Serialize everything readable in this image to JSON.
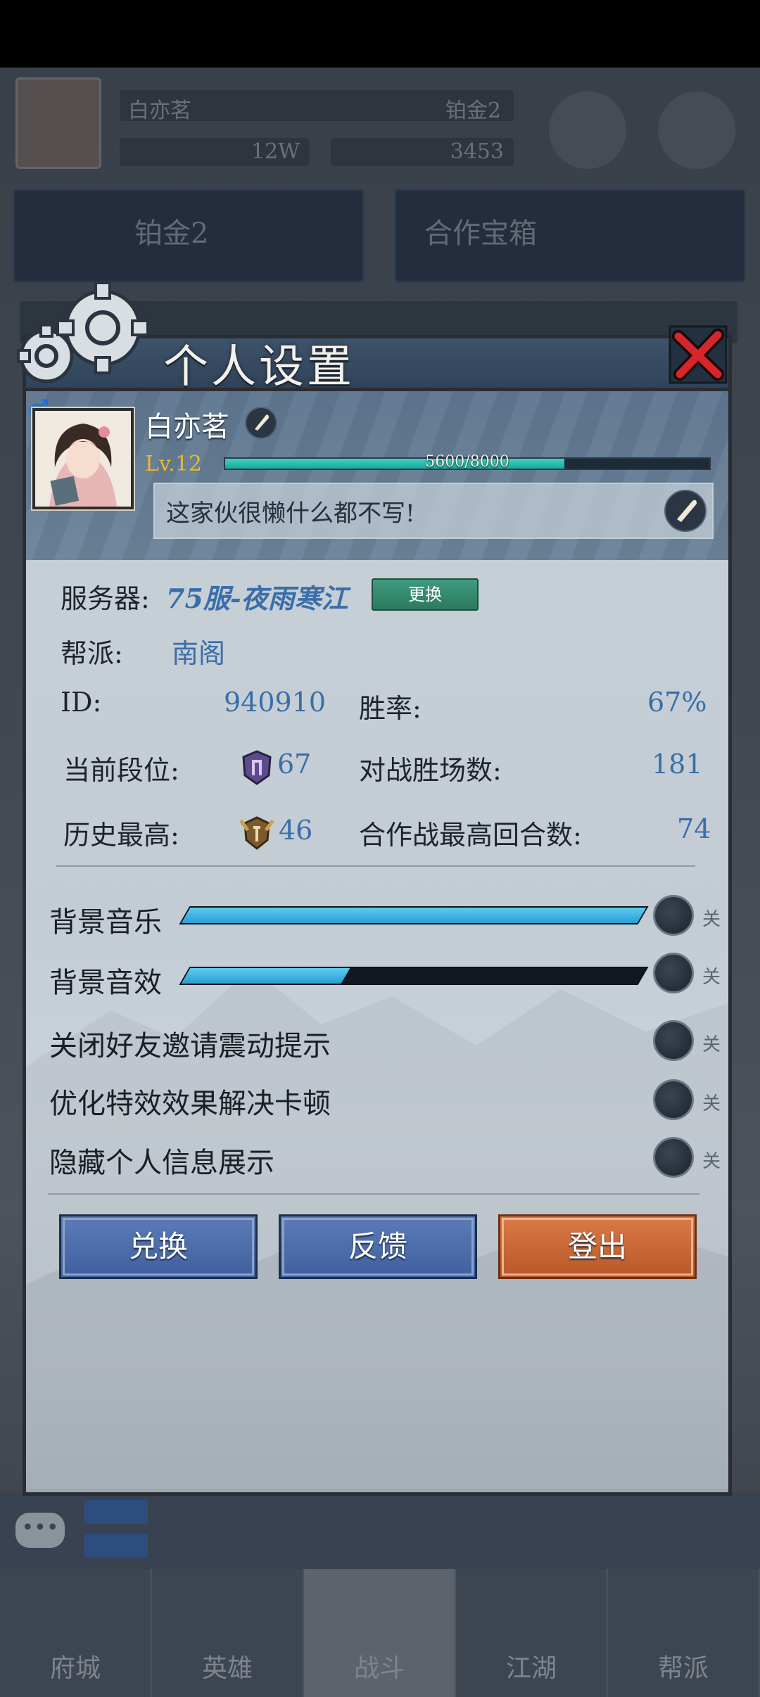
{
  "hud": {
    "player_name": "白亦茗",
    "rank": "铂金2",
    "resource1": "12W",
    "resource2": "3453",
    "banner1": "铂金2",
    "banner2": "合作宝箱"
  },
  "panel": {
    "title": "个人设置"
  },
  "profile": {
    "gender_symbol": "♂",
    "name": "白亦茗",
    "level": "Lv.12",
    "exp_text": "5600/8000",
    "exp_fraction": 0.7,
    "signature": "这家伙很懒什么都不写!"
  },
  "info": {
    "server_label": "服务器:",
    "server_value": "75服-夜雨寒江",
    "change_button": "更换",
    "guild_label": "帮派:",
    "guild_value": "南阁",
    "id_label": "ID:",
    "id_value": "940910",
    "winrate_label": "胜率:",
    "winrate_value": "67%",
    "rank_label": "当前段位:",
    "rank_value": "67",
    "wins_label": "对战胜场数:",
    "wins_value": "181",
    "best_label": "历史最高:",
    "best_value": "46",
    "coop_label": "合作战最高回合数:",
    "coop_value": "74"
  },
  "settings": {
    "music_label": "背景音乐",
    "music_level": 1.0,
    "sfx_label": "背景音效",
    "sfx_level": 0.35,
    "vibration_label": "关闭好友邀请震动提示",
    "optimize_label": "优化特效效果解决卡顿",
    "hide_label": "隐藏个人信息展示",
    "off_text": "关"
  },
  "buttons": {
    "redeem": "兑换",
    "feedback": "反馈",
    "logout": "登出"
  },
  "chat": {
    "bubble": "•••"
  },
  "nav": {
    "items": [
      "府城",
      "英雄",
      "战斗",
      "江湖",
      "帮派"
    ]
  }
}
